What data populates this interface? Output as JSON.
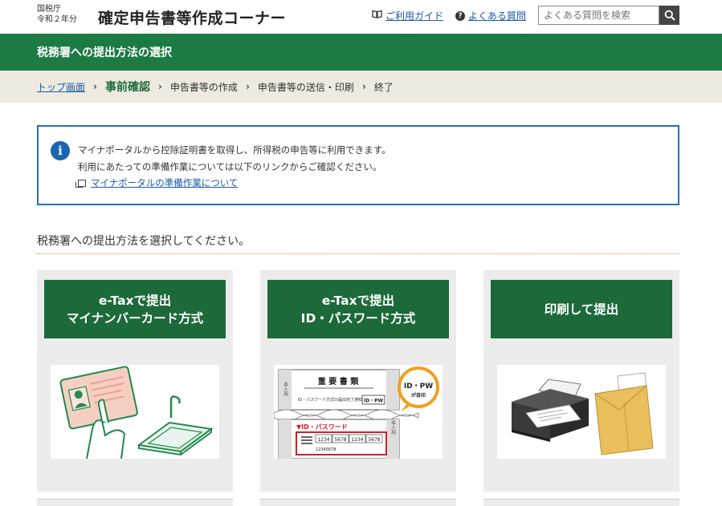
{
  "header": {
    "agency": "国税庁",
    "year": "令和２年分",
    "title": "確定申告書等作成コーナー",
    "guide_link": "ご利用ガイド",
    "faq_link": "よくある質問",
    "search_placeholder": "よくある質問を検索"
  },
  "banner": {
    "title": "税務署への提出方法の選択"
  },
  "breadcrumb": {
    "items": [
      "トップ画面",
      "事前確認",
      "申告書等の作成",
      "申告書等の送信・印刷",
      "終了"
    ]
  },
  "info": {
    "icon": "i",
    "line1": "マイナポータルから控除証明書を取得し、所得税の申告等に利用できます。",
    "line2": "利用にあたっての準備作業については以下のリンクからご確認ください。",
    "link": "マイナポータルの準備作業について"
  },
  "section_heading": "税務署への提出方法を選択してください。",
  "cards": [
    {
      "line1": "e-Taxで提出",
      "line2": "マイナンバーカード方式"
    },
    {
      "line1": "e-Taxで提出",
      "line2": "ID・パスワード方式"
    },
    {
      "line1": "印刷して提出",
      "line2": ""
    }
  ],
  "illustration_text": {
    "doc_title": "重 要 書 類",
    "doc_sub": "ID・パスワード方式の届出完了通知",
    "doc_id_label": "ID・PW",
    "badge_line1": "ID・PW",
    "badge_line2": "が目印",
    "red_label": "▼ID・パスワード",
    "side_left": "本人用",
    "side_right": "本人用",
    "codes": [
      "1234",
      "5678",
      "1234",
      "5678"
    ],
    "small_code": "12345678"
  },
  "colors": {
    "brand_green": "#1c7a43",
    "button_green": "#1c6a3a",
    "link_blue": "#1a5aa8",
    "info_border": "#2572b8",
    "breadcrumb_bg": "#eeeae0"
  }
}
